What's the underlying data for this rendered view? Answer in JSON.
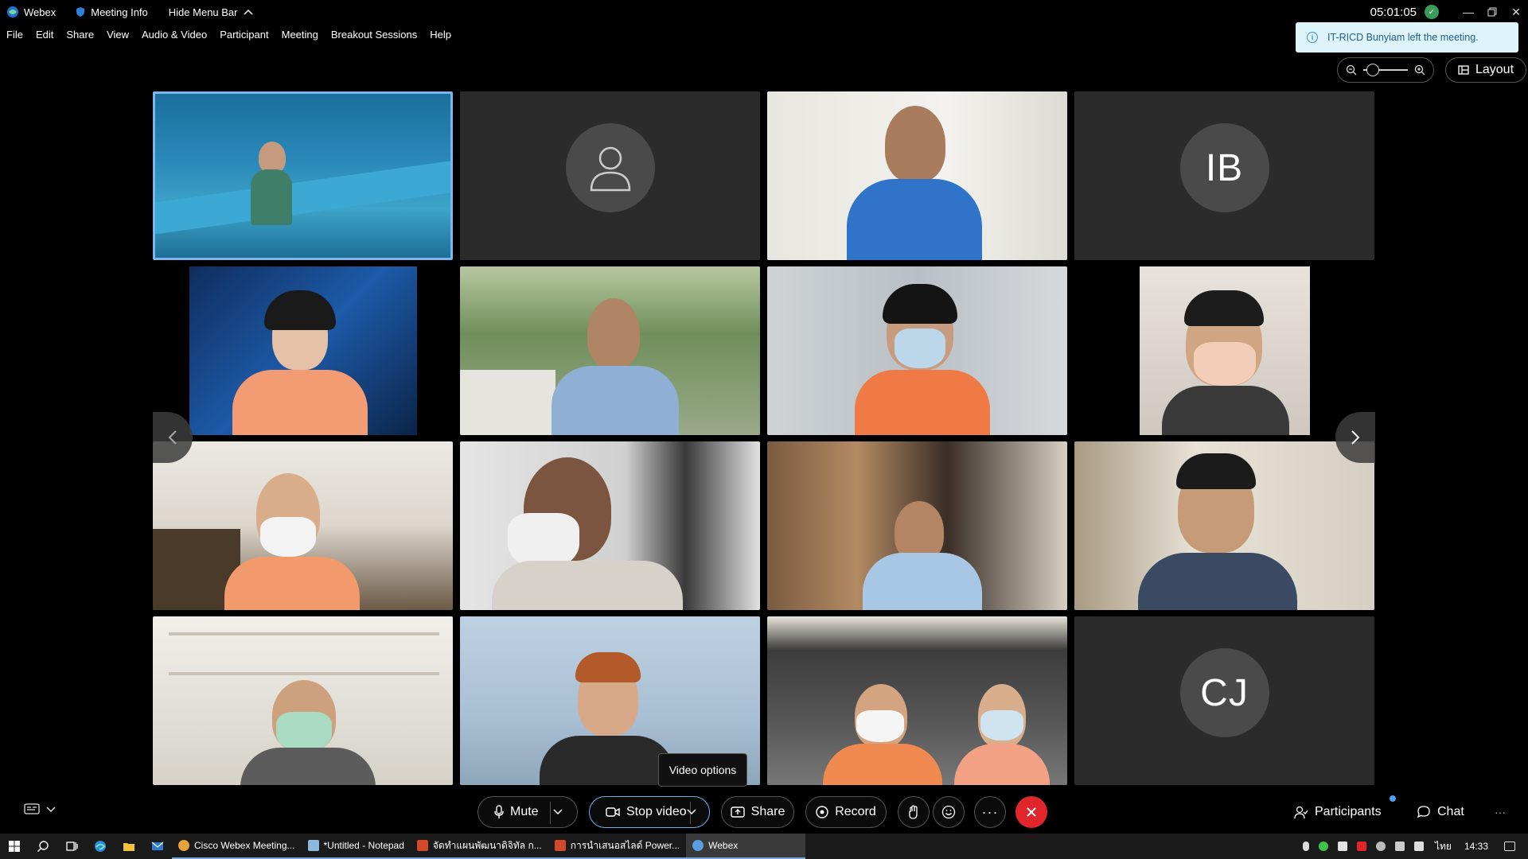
{
  "titlebar": {
    "app_name": "Webex",
    "meeting_info": "Meeting Info",
    "hide_menu": "Hide Menu Bar",
    "clock": "05:01:05"
  },
  "menu": [
    "File",
    "Edit",
    "Share",
    "View",
    "Audio & Video",
    "Participant",
    "Meeting",
    "Breakout Sessions",
    "Help"
  ],
  "notification": "IT-RICD Bunyiam left the meeting.",
  "layout_label": "Layout",
  "tiles": [
    {
      "type": "video",
      "active": true
    },
    {
      "type": "placeholder"
    },
    {
      "type": "video"
    },
    {
      "type": "initials",
      "initials": "IB"
    },
    {
      "type": "video"
    },
    {
      "type": "video"
    },
    {
      "type": "video"
    },
    {
      "type": "video"
    },
    {
      "type": "video"
    },
    {
      "type": "video"
    },
    {
      "type": "video"
    },
    {
      "type": "video"
    },
    {
      "type": "video"
    },
    {
      "type": "video"
    },
    {
      "type": "video"
    },
    {
      "type": "initials",
      "initials": "CJ"
    }
  ],
  "tooltip": "Video options",
  "controls": {
    "mute": "Mute",
    "stop_video": "Stop video",
    "share": "Share",
    "record": "Record",
    "participants": "Participants",
    "chat": "Chat"
  },
  "taskbar": {
    "apps": [
      {
        "label": "Cisco Webex Meeting...",
        "color": "#e8a33d",
        "state": "open"
      },
      {
        "label": "*Untitled - Notepad",
        "color": "#8fb8de",
        "state": "open"
      },
      {
        "label": "จัดทำแผนพัฒนาดิจิทัล ก...",
        "color": "#d04a2a",
        "state": "open"
      },
      {
        "label": "การนำเสนอสไลด์ Power...",
        "color": "#d04a2a",
        "state": "open"
      },
      {
        "label": "Webex",
        "color": "#5aa0e0",
        "state": "active"
      }
    ],
    "lang": "ไทย",
    "time": "14:33"
  },
  "colors": {
    "accent": "#7ab7f0",
    "end_call": "#e0262a",
    "toast_bg": "#dff3fb",
    "toast_text": "#1b5f8a"
  }
}
